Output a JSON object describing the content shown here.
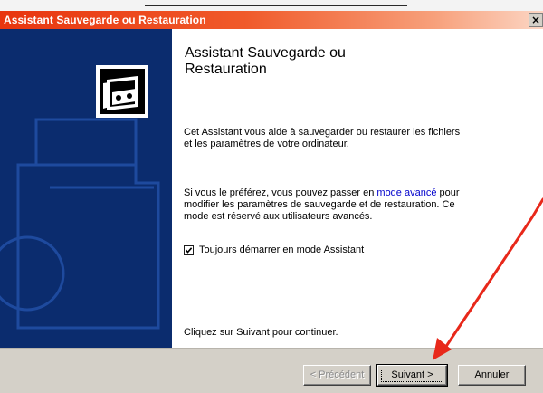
{
  "window": {
    "title": "Assistant Sauvegarde ou Restauration",
    "close_glyph": "×"
  },
  "content": {
    "heading_line1": "Assistant Sauvegarde ou",
    "heading_line2": "Restauration",
    "intro_line1": "Cet Assistant vous aide à sauvegarder ou restaurer les fichiers",
    "intro_line2": "et les paramètres de votre ordinateur.",
    "advanced_before": "Si vous le préférez, vous pouvez passer en ",
    "advanced_link": "mode avancé",
    "advanced_after": " pour",
    "advanced_line2": "modifier les paramètres de sauvegarde et de restauration. Ce",
    "advanced_line3": "mode est réservé aux utilisateurs avancés.",
    "checkbox_label": "Toujours démarrer en mode Assistant",
    "checkbox_checked": true,
    "continue_text": "Cliquez sur Suivant pour continuer."
  },
  "buttons": {
    "previous": "< Précédent",
    "next": "Suivant >",
    "cancel": "Annuler"
  },
  "colors": {
    "titlebar": "#e8350f",
    "sidebar": "#0b2c6e",
    "annotation_arrow": "#e8281a"
  },
  "icons": {
    "wizard": "backup-tape-icon"
  }
}
